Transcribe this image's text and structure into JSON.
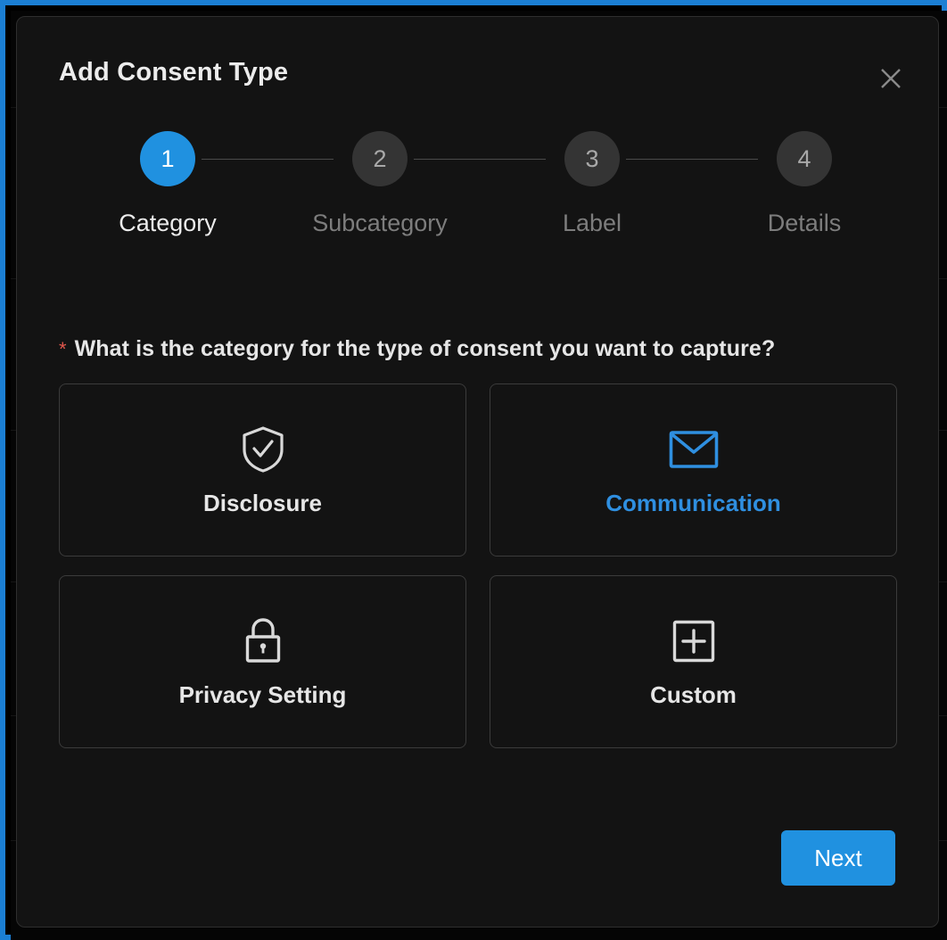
{
  "theme": {
    "accent": "#2091e0",
    "modal_bg": "#131313",
    "page_border": "#1b7fd4",
    "required_red": "#e2574c",
    "muted_text": "#7d7d7d"
  },
  "modal": {
    "title": "Add Consent Type",
    "close_label": "X"
  },
  "stepper": {
    "steps": [
      {
        "number": "1",
        "label": "Category",
        "state": "active"
      },
      {
        "number": "2",
        "label": "Subcategory",
        "state": "inactive"
      },
      {
        "number": "3",
        "label": "Label",
        "state": "inactive"
      },
      {
        "number": "4",
        "label": "Details",
        "state": "inactive"
      }
    ]
  },
  "question": {
    "asterisk": "*",
    "text": "What is the category for the type of consent you want to capture?"
  },
  "categories": [
    {
      "label": "Disclosure",
      "icon": "shield-check-icon",
      "selected": false
    },
    {
      "label": "Communication",
      "icon": "envelope-icon",
      "selected": true
    },
    {
      "label": "Privacy Setting",
      "icon": "lock-icon",
      "selected": false
    },
    {
      "label": "Custom",
      "icon": "plus-square-icon",
      "selected": false
    }
  ],
  "footer": {
    "next_label": "Next"
  }
}
